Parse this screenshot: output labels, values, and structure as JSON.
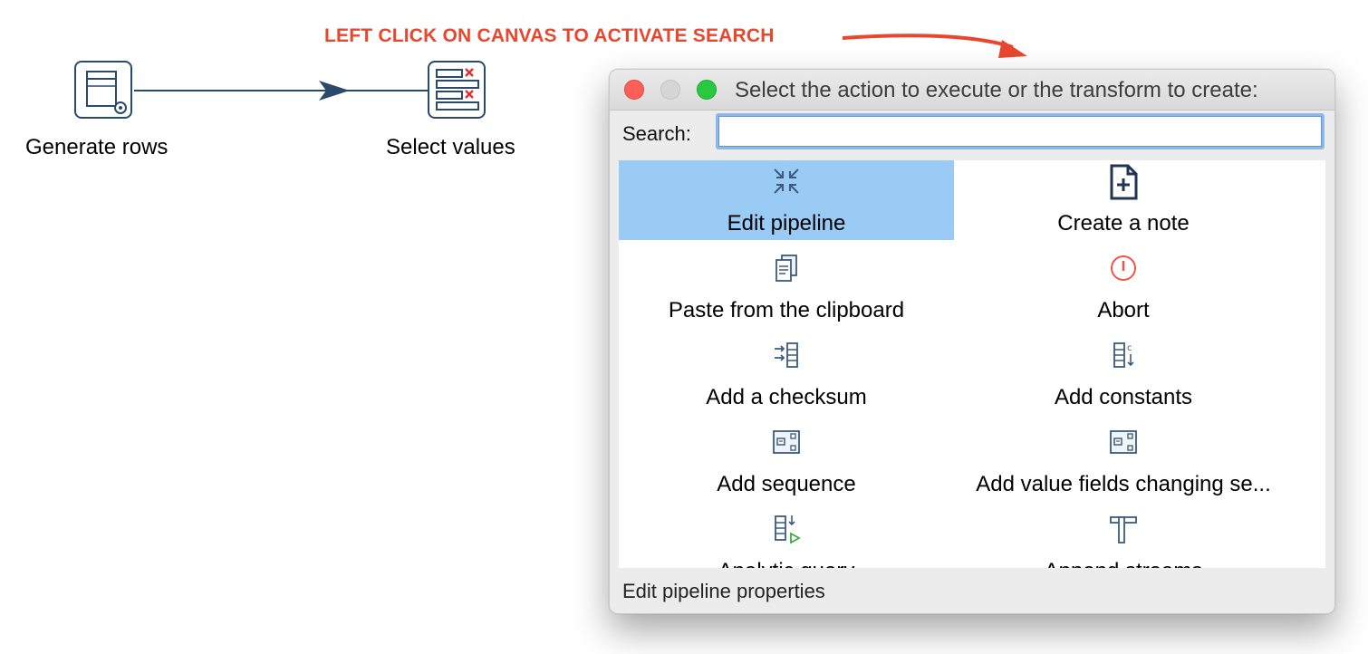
{
  "annotation": {
    "text": "LEFT  CLICK ON CANVAS TO ACTIVATE SEARCH",
    "color": "#e8472d"
  },
  "pipeline": {
    "nodes": [
      {
        "label": "Generate rows",
        "icon": "generate-rows-icon"
      },
      {
        "label": "Select values",
        "icon": "select-values-icon"
      }
    ],
    "hop_color": "#2a4a6b"
  },
  "dialog": {
    "title": "Select the action to execute or the transform to create:",
    "search": {
      "label": "Search:",
      "value": "",
      "placeholder": ""
    },
    "items": [
      {
        "label": "Edit pipeline",
        "icon": "collapse-arrows-icon",
        "selected": true
      },
      {
        "label": "Create a note",
        "icon": "new-document-icon",
        "selected": false
      },
      {
        "label": "Paste from the clipboard",
        "icon": "clipboard-icon",
        "selected": false
      },
      {
        "label": "Abort",
        "icon": "abort-icon",
        "selected": false
      },
      {
        "label": "Add a checksum",
        "icon": "checksum-icon",
        "selected": false
      },
      {
        "label": "Add constants",
        "icon": "constants-icon",
        "selected": false
      },
      {
        "label": "Add sequence",
        "icon": "sequence-icon",
        "selected": false
      },
      {
        "label": "Add value fields changing se...",
        "icon": "value-fields-icon",
        "selected": false
      },
      {
        "label": "Analytic query",
        "icon": "analytic-icon",
        "selected": false
      },
      {
        "label": "Append streams",
        "icon": "append-icon",
        "selected": false
      }
    ],
    "status": "Edit pipeline properties",
    "selection_color": "#99cbf5"
  }
}
